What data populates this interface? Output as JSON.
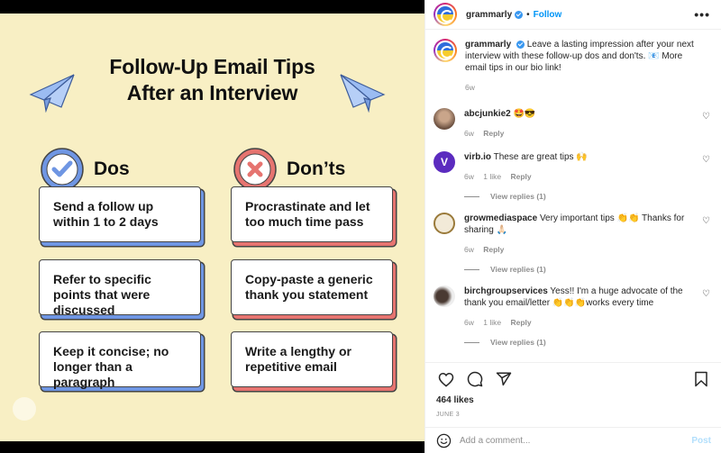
{
  "poster": {
    "title_line1": "Follow-Up Email Tips",
    "title_line2": "After an Interview",
    "dos_label": "Dos",
    "donts_label": "Don’ts",
    "dos": [
      "Send a follow up within 1 to 2 days",
      "Refer to specific points that were discussed",
      "Keep it concise; no longer than a paragraph"
    ],
    "donts": [
      "Procrastinate and let too much time pass",
      "Copy-paste a generic thank you statement",
      "Write a lengthy or repetitive email"
    ],
    "colors": {
      "background": "#f8efc4",
      "do_accent": "#6f96e3",
      "dont_accent": "#e67470"
    }
  },
  "header": {
    "username": "grammarly",
    "separator": "•",
    "follow_label": "Follow",
    "more_label": "•••"
  },
  "caption": {
    "username": "grammarly",
    "text": "Leave a lasting impression after your next interview with these follow-up dos and don'ts. 📧 More email tips in our bio link!",
    "time": "6w"
  },
  "comments": [
    {
      "username": "abcjunkie2",
      "text": "🤩😎",
      "time": "6w",
      "likes": "",
      "reply_label": "Reply",
      "view_replies": ""
    },
    {
      "username": "virb.io",
      "text": "These are great tips 🙌",
      "time": "6w",
      "likes": "1 like",
      "reply_label": "Reply",
      "view_replies": "View replies (1)"
    },
    {
      "username": "growmediaspace",
      "text": "Very important tips 👏👏 Thanks for sharing 🙏🏻",
      "time": "6w",
      "likes": "",
      "reply_label": "Reply",
      "view_replies": "View replies (1)"
    },
    {
      "username": "birchgroupservices",
      "text": "Yess!! I'm a huge advocate of the thank you email/letter 👏👏👏works every time",
      "time": "6w",
      "likes": "1 like",
      "reply_label": "Reply",
      "view_replies": "View replies (1)"
    }
  ],
  "post": {
    "likes": "464 likes",
    "date": "JUNE 3"
  },
  "add_comment": {
    "placeholder": "Add a comment...",
    "post_label": "Post"
  },
  "icons": {
    "like": "heart-icon",
    "comment": "comment-bubble-icon",
    "share": "paper-plane-icon",
    "save": "bookmark-icon",
    "emoji": "smiley-icon"
  }
}
